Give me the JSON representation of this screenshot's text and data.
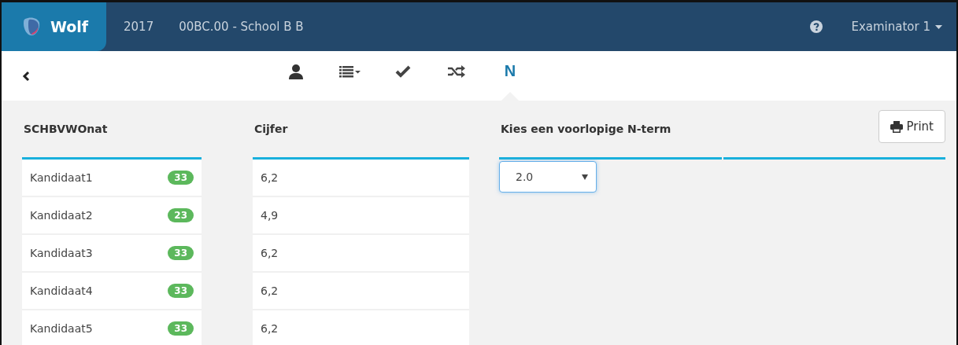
{
  "header": {
    "app_name": "Wolf",
    "year": "2017",
    "school": "00BC.00 - School B B",
    "user": "Examinator 1"
  },
  "toolbar": {
    "tabs": [
      {
        "kind": "person",
        "selected": false
      },
      {
        "kind": "list",
        "selected": false
      },
      {
        "kind": "check",
        "selected": false
      },
      {
        "kind": "shuffle",
        "selected": false
      },
      {
        "kind": "text",
        "label": "N",
        "selected": true
      }
    ]
  },
  "candidates": {
    "heading": "SCHBVWOnat",
    "rows": [
      {
        "name": "Kandidaat1",
        "score": "33"
      },
      {
        "name": "Kandidaat2",
        "score": "23"
      },
      {
        "name": "Kandidaat3",
        "score": "33"
      },
      {
        "name": "Kandidaat4",
        "score": "33"
      },
      {
        "name": "Kandidaat5",
        "score": "33"
      }
    ]
  },
  "grades": {
    "heading": "Cijfer",
    "rows": [
      "6,2",
      "4,9",
      "6,2",
      "6,2",
      "6,2"
    ]
  },
  "nterm": {
    "heading": "Kies een voorlopige N-term",
    "value": "2.0"
  },
  "print_button": "Print"
}
